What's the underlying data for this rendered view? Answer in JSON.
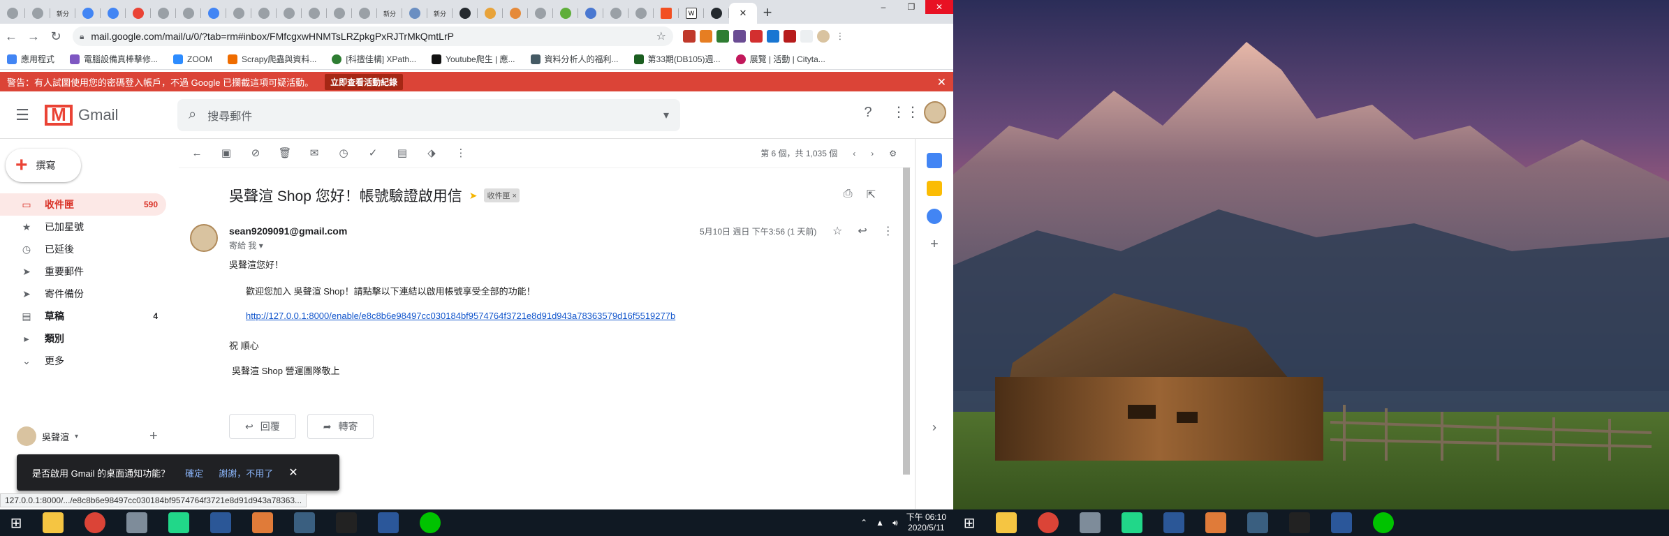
{
  "browser": {
    "url": "mail.google.com/mail/u/0/?tab=rm#inbox/FMfcgxwHNMTsLRZpkgPxRJTrMkQmtLrP",
    "tabs": [
      "",
      "",
      "新分",
      "",
      "",
      "",
      "",
      "",
      "",
      "",
      "",
      "",
      "",
      "",
      "",
      "新分",
      "",
      "新分",
      "",
      "",
      "",
      "",
      "",
      "",
      "",
      "",
      "",
      "",
      ""
    ],
    "new_tab_label": "+",
    "win_min": "–",
    "win_max": "❐",
    "win_close": "✕"
  },
  "bookmarks": [
    "應用程式",
    "電腦設備真棒擊修...",
    "ZOOM",
    "Scrapy爬蟲與資料...",
    "[科擅佳構] XPath...",
    "Youtube爬生 | 應...",
    "資料分析人的福利...",
    "第33期(DB105)週...",
    "展覽 | 活動 | Cityta..."
  ],
  "warning": {
    "text": "警告：有人試圖使用您的密碼登入帳戶，不過 Google 已攔截這項可疑活動。",
    "button": "立即查看活動紀錄",
    "close": "✕"
  },
  "gmail": {
    "logo_text": "Gmail",
    "search_placeholder": "搜尋郵件",
    "compose": "撰寫",
    "nav": [
      {
        "icon": "▭",
        "label": "收件匣",
        "count": "590"
      },
      {
        "icon": "★",
        "label": "已加星號",
        "count": ""
      },
      {
        "icon": "◷",
        "label": "已延後",
        "count": ""
      },
      {
        "icon": "➤",
        "label": "重要郵件",
        "count": ""
      },
      {
        "icon": "➤",
        "label": "寄件備份",
        "count": ""
      },
      {
        "icon": "▤",
        "label": "草稿",
        "count": "4"
      },
      {
        "icon": "▸",
        "label": "類別",
        "count": ""
      },
      {
        "icon": "⌄",
        "label": "更多",
        "count": ""
      }
    ],
    "user_name": "吳聲渲",
    "pager_text": "第 6 個，共 1,035 個"
  },
  "message": {
    "subject": "吳聲渲 Shop 您好！帳號驗證啟用信",
    "label": "收件匣",
    "label_x": "×",
    "sender": "sean9209091@gmail.com",
    "to": "寄給 我",
    "date": "5月10日 週日 下午3:56 (1 天前)",
    "body_greeting": "吳聲渲您好！",
    "body_line": "歡迎您加入 吳聲渲 Shop！請點擊以下連結以啟用帳號享受全部的功能！",
    "body_link": "http://127.0.0.1:8000/enable/e8c8b6e98497cc030184bf9574764f3721e8d91d943a78363579d16f5519277b",
    "body_closing": "祝 順心",
    "body_signature": "吳聲渲 Shop 營運團隊敬上",
    "reply": "回覆",
    "forward": "轉寄"
  },
  "snackbar": {
    "text": "是否啟用 Gmail 的桌面通知功能？",
    "confirm": "確定",
    "decline": "謝謝，不用了",
    "close": "✕"
  },
  "status_url": "127.0.0.1:8000/.../e8c8b6e98497cc030184bf9574764f3721e8d91d943a78363...",
  "clock": {
    "time": "下午 06:10",
    "date": "2020/5/11"
  }
}
